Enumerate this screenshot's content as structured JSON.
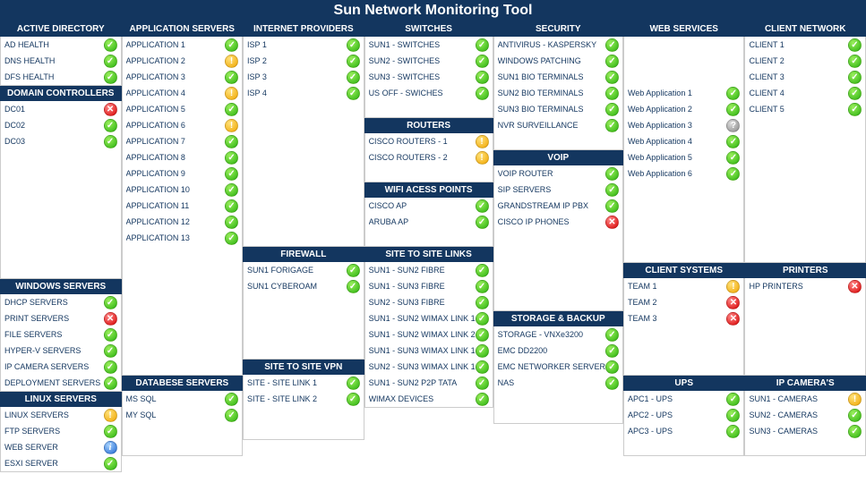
{
  "title": "Sun Network Monitoring Tool",
  "columns": [
    [
      {
        "header": "ACTIVE DIRECTORY",
        "items": [
          {
            "label": "AD HEALTH",
            "status": "ok"
          },
          {
            "label": "DNS HEALTH",
            "status": "ok"
          },
          {
            "label": "DFS HEALTH",
            "status": "ok"
          }
        ]
      },
      {
        "header": "DOMAIN CONTROLLERS",
        "items": [
          {
            "label": "DC01",
            "status": "err"
          },
          {
            "label": "DC02",
            "status": "ok"
          },
          {
            "label": "DC03",
            "status": "ok"
          }
        ],
        "trailingSpacers": 8
      },
      {
        "header": "WINDOWS SERVERS",
        "items": [
          {
            "label": "DHCP SERVERS",
            "status": "ok"
          },
          {
            "label": "PRINT SERVERS",
            "status": "err"
          },
          {
            "label": "FILE SERVERS",
            "status": "ok"
          },
          {
            "label": "HYPER-V SERVERS",
            "status": "ok"
          },
          {
            "label": "IP CAMERA SERVERS",
            "status": "ok"
          },
          {
            "label": "DEPLOYMENT SERVERS",
            "status": "ok"
          }
        ]
      },
      {
        "header": "LINUX SERVERS",
        "items": [
          {
            "label": "LINUX SERVERS",
            "status": "warn"
          },
          {
            "label": "FTP SERVERS",
            "status": "ok"
          },
          {
            "label": "WEB SERVER",
            "status": "info"
          },
          {
            "label": "ESXI SERVER",
            "status": "ok"
          }
        ]
      }
    ],
    [
      {
        "header": "APPLICATION SERVERS",
        "items": [
          {
            "label": "APPLICATION 1",
            "status": "ok"
          },
          {
            "label": "APPLICATION 2",
            "status": "warn"
          },
          {
            "label": "APPLICATION 3",
            "status": "ok"
          },
          {
            "label": "APPLICATION 4",
            "status": "warn"
          },
          {
            "label": "APPLICATION 5",
            "status": "ok"
          },
          {
            "label": "APPLICATION 6",
            "status": "warn"
          },
          {
            "label": "APPLICATION 7",
            "status": "ok"
          },
          {
            "label": "APPLICATION 8",
            "status": "ok"
          },
          {
            "label": "APPLICATION 9",
            "status": "ok"
          },
          {
            "label": "APPLICATION 10",
            "status": "ok"
          },
          {
            "label": "APPLICATION 11",
            "status": "ok"
          },
          {
            "label": "APPLICATION 12",
            "status": "ok"
          },
          {
            "label": "APPLICATION 13",
            "status": "ok"
          }
        ],
        "trailingSpacers": 8
      },
      {
        "header": "DATABESE SERVERS",
        "items": [
          {
            "label": "MS SQL",
            "status": "ok"
          },
          {
            "label": "MY SQL",
            "status": "ok"
          }
        ],
        "trailingSpacers": 2
      }
    ],
    [
      {
        "header": "INTERNET PROVIDERS",
        "items": [
          {
            "label": "ISP 1",
            "status": "ok"
          },
          {
            "label": "ISP 2",
            "status": "ok"
          },
          {
            "label": "ISP 3",
            "status": "ok"
          },
          {
            "label": "ISP 4",
            "status": "ok"
          }
        ],
        "trailingSpacers": 9
      },
      {
        "header": "FIREWALL",
        "items": [
          {
            "label": "SUN1 FORIGAGE",
            "status": "ok"
          },
          {
            "label": "SUN1 CYBEROAM",
            "status": "ok"
          }
        ],
        "trailingSpacers": 4
      },
      {
        "header": "SITE TO SITE VPN",
        "items": [
          {
            "label": "SITE - SITE LINK 1",
            "status": "ok"
          },
          {
            "label": "SITE - SITE LINK 2",
            "status": "ok"
          }
        ],
        "trailingSpacers": 2
      }
    ],
    [
      {
        "header": "SWITCHES",
        "items": [
          {
            "label": "SUN1 - SWITCHES",
            "status": "ok"
          },
          {
            "label": "SUN2 - SWITCHES",
            "status": "ok"
          },
          {
            "label": "SUN3 - SWITCHES",
            "status": "ok"
          },
          {
            "label": "US OFF - SWICHES",
            "status": "ok"
          }
        ],
        "trailingSpacers": 1
      },
      {
        "header": "ROUTERS",
        "items": [
          {
            "label": "CISCO ROUTERS - 1",
            "status": "warn"
          },
          {
            "label": "CISCO ROUTERS - 2",
            "status": "warn"
          }
        ],
        "trailingSpacers": 1
      },
      {
        "header": "WIFI ACESS POINTS",
        "items": [
          {
            "label": "CISCO AP",
            "status": "ok"
          },
          {
            "label": "ARUBA AP",
            "status": "ok"
          }
        ],
        "trailingSpacers": 1
      },
      {
        "header": "SITE TO SITE LINKS",
        "items": [
          {
            "label": "SUN1 - SUN2 FIBRE",
            "status": "ok"
          },
          {
            "label": "SUN1 - SUN3 FIBRE",
            "status": "ok"
          },
          {
            "label": "SUN2 - SUN3 FIBRE",
            "status": "ok"
          },
          {
            "label": "SUN1 - SUN2 WIMAX LINK 1",
            "status": "ok"
          },
          {
            "label": "SUN1 - SUN2 WIMAX LINK 2",
            "status": "ok"
          },
          {
            "label": "SUN1 - SUN3 WIMAX LINK 1",
            "status": "ok"
          },
          {
            "label": "SUN2 - SUN3 WIMAX LINK 1",
            "status": "ok"
          },
          {
            "label": "SUN1 - SUN2 P2P TATA",
            "status": "ok"
          },
          {
            "label": "WIMAX DEVICES",
            "status": "ok"
          }
        ]
      }
    ],
    [
      {
        "header": "SECURITY",
        "items": [
          {
            "label": "ANTIVIRUS - KASPERSKY",
            "status": "ok"
          },
          {
            "label": "WINDOWS PATCHING",
            "status": "ok"
          },
          {
            "label": "SUN1 BIO TERMINALS",
            "status": "ok"
          },
          {
            "label": "SUN2 BIO TERMINALS",
            "status": "ok"
          },
          {
            "label": "SUN3 BIO TERMINALS",
            "status": "ok"
          },
          {
            "label": "NVR SURVEILLANCE",
            "status": "ok"
          }
        ],
        "trailingSpacers": 1
      },
      {
        "header": "VOIP",
        "items": [
          {
            "label": "VOIP ROUTER",
            "status": "ok"
          },
          {
            "label": "SIP SERVERS",
            "status": "ok"
          },
          {
            "label": "GRANDSTREAM IP PBX",
            "status": "ok"
          },
          {
            "label": "CISCO IP PHONES",
            "status": "err"
          }
        ],
        "trailingSpacers": 5
      },
      {
        "header": "STORAGE & BACKUP",
        "items": [
          {
            "label": "STORAGE - VNXe3200",
            "status": "ok"
          },
          {
            "label": "EMC DD2200",
            "status": "ok"
          },
          {
            "label": "EMC NETWORKER SERVER",
            "status": "ok"
          },
          {
            "label": "NAS",
            "status": "ok"
          }
        ],
        "trailingSpacers": 2
      }
    ],
    [
      {
        "header": "WEB SERVICES",
        "items": [
          {
            "label": "",
            "status": ""
          },
          {
            "label": "",
            "status": ""
          },
          {
            "label": "",
            "status": ""
          },
          {
            "label": "Web Application 1",
            "status": "ok"
          },
          {
            "label": "Web Application 2",
            "status": "ok"
          },
          {
            "label": "Web Application 3",
            "status": "unk"
          },
          {
            "label": "Web Application 4",
            "status": "ok"
          },
          {
            "label": "Web Application 5",
            "status": "ok"
          },
          {
            "label": "Web Application 6",
            "status": "ok"
          }
        ],
        "trailingSpacers": 5
      },
      {
        "header": "CLIENT SYSTEMS",
        "items": [
          {
            "label": "TEAM 1",
            "status": "warn"
          },
          {
            "label": "TEAM 2",
            "status": "err"
          },
          {
            "label": "TEAM 3",
            "status": "err"
          }
        ],
        "trailingSpacers": 3
      },
      {
        "header": "UPS",
        "items": [
          {
            "label": "APC1 -  UPS",
            "status": "ok"
          },
          {
            "label": "APC2 - UPS",
            "status": "ok"
          },
          {
            "label": "APC3 - UPS",
            "status": "ok"
          }
        ],
        "trailingSpacers": 1
      }
    ],
    [
      {
        "header": "CLIENT NETWORK",
        "items": [
          {
            "label": "CLIENT 1",
            "status": "ok"
          },
          {
            "label": "CLIENT 2",
            "status": "ok"
          },
          {
            "label": "CLIENT 3",
            "status": "ok"
          },
          {
            "label": "CLIENT 4",
            "status": "ok"
          },
          {
            "label": "CLIENT 5",
            "status": "ok"
          }
        ],
        "trailingSpacers": 9
      },
      {
        "header": "PRINTERS",
        "items": [
          {
            "label": "HP PRINTERS",
            "status": "err"
          }
        ],
        "trailingSpacers": 5
      },
      {
        "header": "IP CAMERA'S",
        "items": [
          {
            "label": "SUN1 - CAMERAS",
            "status": "warn"
          },
          {
            "label": "SUN2 - CAMERAS",
            "status": "ok"
          },
          {
            "label": "SUN3 - CAMERAS",
            "status": "ok"
          }
        ],
        "trailingSpacers": 1
      }
    ]
  ]
}
